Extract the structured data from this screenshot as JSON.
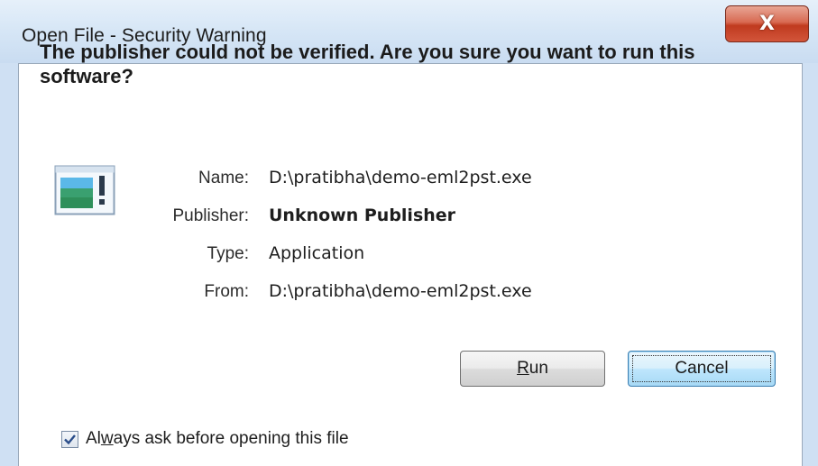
{
  "window": {
    "title": "Open File - Security Warning",
    "close_glyph": "X"
  },
  "dialog": {
    "headline": "The publisher could not be verified.  Are you sure you want to run this software?",
    "icon": "application-icon",
    "fields": {
      "name_label": "Name:",
      "name_value": "D:\\pratibha\\demo-eml2pst.exe",
      "publisher_label": "Publisher:",
      "publisher_value": "Unknown Publisher",
      "type_label": "Type:",
      "type_value": "Application",
      "from_label": "From:",
      "from_value": "D:\\pratibha\\demo-eml2pst.exe"
    }
  },
  "buttons": {
    "run_label_accel": "R",
    "run_label_rest": "un",
    "cancel_label": "Cancel"
  },
  "checkbox": {
    "checked": true,
    "label_pre": "Al",
    "label_accel": "w",
    "label_post": "ays ask before opening this file"
  },
  "colors": {
    "close_button": "#c03a1f",
    "focus_button": "#3c7fb1",
    "frame": "#cfe0f3"
  }
}
